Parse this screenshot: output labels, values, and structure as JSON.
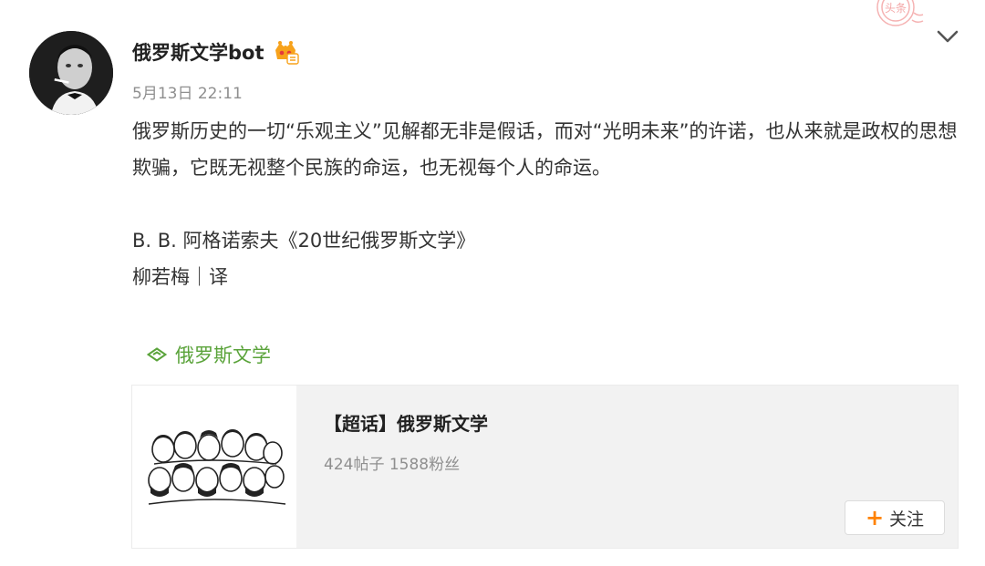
{
  "post": {
    "username": "俄罗斯文学bot",
    "time": "5月13日 22:11",
    "paragraphs": [
      "俄罗斯历史的一切“乐观主义”见解都无非是假话，而对“光明未来”的许诺，也从来就是政权的思想欺骗，它既无视整个民族的命运，也无视每个人的命运。"
    ],
    "source_lines": [
      "B. B. 阿格诺索夫《20世纪俄罗斯文学》",
      "柳若梅｜译"
    ]
  },
  "stamp": {
    "text": "头条"
  },
  "topic": {
    "label": "俄罗斯文学",
    "icon": "supertopic-icon"
  },
  "card": {
    "title": "【超话】俄罗斯文学",
    "stats": "424帖子 1588粉丝",
    "follow_label": "关注",
    "image": "writers-portraits-illustration"
  },
  "colors": {
    "topic_green": "#5aa33a",
    "follow_plus": "#ff8200",
    "card_bg": "#f2f2f2",
    "meta_gray": "#8f8f8f"
  }
}
